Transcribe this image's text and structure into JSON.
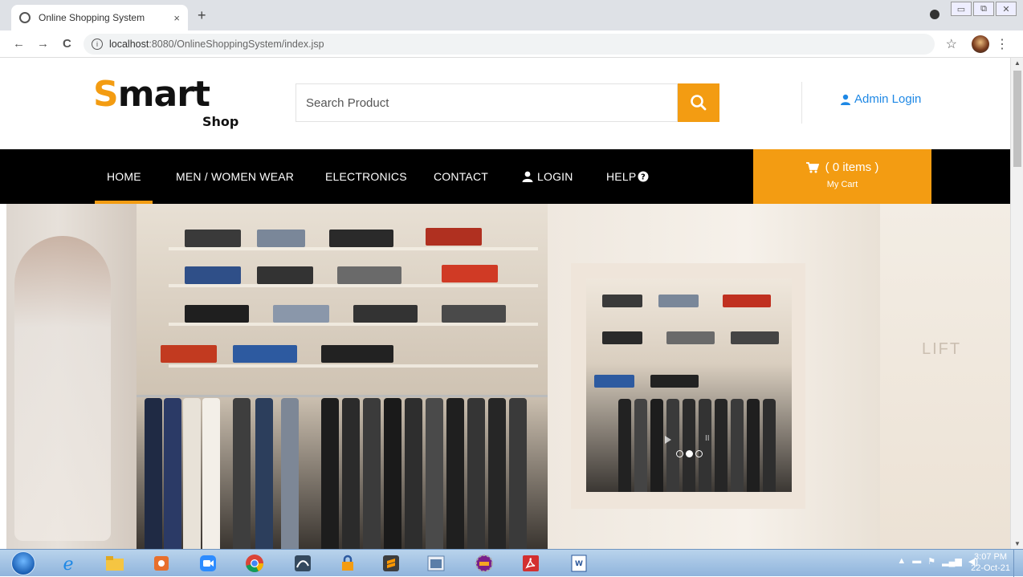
{
  "browser": {
    "tab_title": "Online Shopping System",
    "tab_close": "×",
    "new_tab": "+",
    "url_host": "localhost",
    "url_rest": ":8080/OnlineShoppingSystem/index.jsp",
    "back": "←",
    "forward": "→",
    "reload": "C",
    "bookmark_icon": "star-icon",
    "menu_icon": "kebab-icon"
  },
  "site": {
    "logo_main_s": "S",
    "logo_main_rest": "mart",
    "logo_sub": "Shop",
    "search_placeholder": "Search Product",
    "admin_login": "Admin Login",
    "brand_color": "#f39c12"
  },
  "nav": {
    "items": [
      {
        "label": "HOME"
      },
      {
        "label": "MEN / WOMEN WEAR"
      },
      {
        "label": "ELECTRONICS"
      },
      {
        "label": "CONTACT"
      },
      {
        "label": "LOGIN"
      },
      {
        "label": "HELP"
      }
    ],
    "cart_count": "( 0 items )",
    "cart_label": "My Cart"
  },
  "hero": {
    "slides": 3,
    "active_slide": 2,
    "wall_text": "LIFT"
  },
  "taskbar": {
    "time": "3:07 PM",
    "date": "22-Oct-21"
  }
}
